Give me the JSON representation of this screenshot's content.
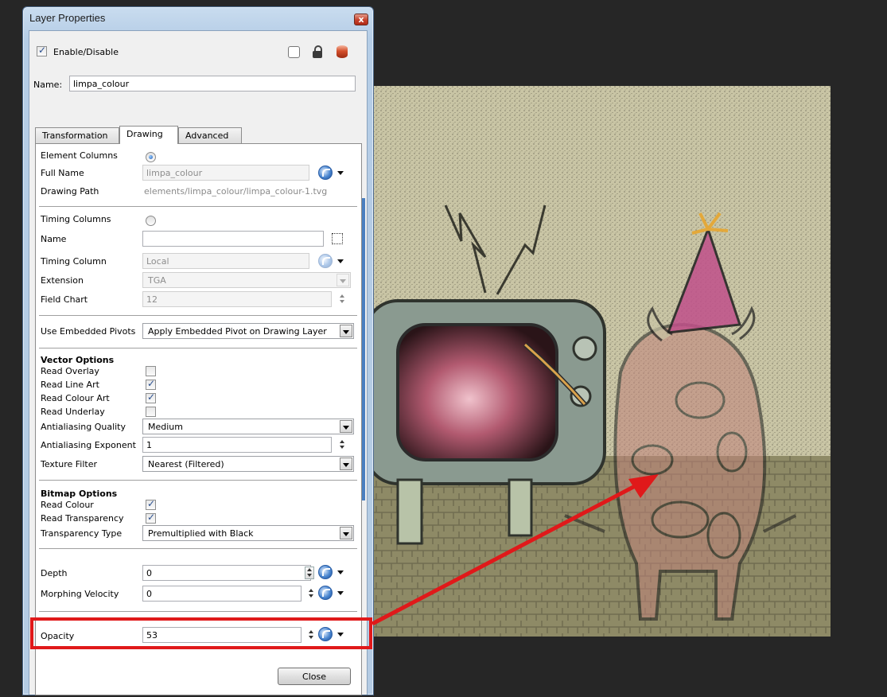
{
  "window": {
    "title": "Layer Properties",
    "close_glyph": "x"
  },
  "header": {
    "enable_label": "Enable/Disable",
    "enable_checked": true,
    "name_label": "Name:",
    "name_value": "limpa_colour"
  },
  "tabs": [
    {
      "label": "Transformation",
      "active": false
    },
    {
      "label": "Drawing",
      "active": true
    },
    {
      "label": "Advanced",
      "active": false
    }
  ],
  "element": {
    "columns_label": "Element Columns",
    "full_name_label": "Full Name",
    "full_name_value": "limpa_colour",
    "drawing_path_label": "Drawing Path",
    "drawing_path_value": "elements/limpa_colour/limpa_colour-1.tvg"
  },
  "timing": {
    "columns_label": "Timing Columns",
    "name_label": "Name",
    "name_value": "",
    "timing_column_label": "Timing Column",
    "timing_column_value": "Local",
    "extension_label": "Extension",
    "extension_value": "TGA",
    "field_chart_label": "Field Chart",
    "field_chart_value": "12"
  },
  "pivots": {
    "label": "Use Embedded Pivots",
    "value": "Apply Embedded Pivot on Drawing Layer"
  },
  "vector": {
    "heading": "Vector Options",
    "read_overlay_label": "Read Overlay",
    "read_overlay": false,
    "read_line_art_label": "Read Line Art",
    "read_line_art": true,
    "read_colour_art_label": "Read Colour Art",
    "read_colour_art": true,
    "read_underlay_label": "Read Underlay",
    "read_underlay": false,
    "aa_quality_label": "Antialiasing Quality",
    "aa_quality_value": "Medium",
    "aa_exponent_label": "Antialiasing Exponent",
    "aa_exponent_value": "1",
    "texture_filter_label": "Texture Filter",
    "texture_filter_value": "Nearest (Filtered)"
  },
  "bitmap": {
    "heading": "Bitmap Options",
    "read_colour_label": "Read Colour",
    "read_colour": true,
    "read_transparency_label": "Read Transparency",
    "read_transparency": true,
    "transparency_type_label": "Transparency Type",
    "transparency_type_value": "Premultiplied with Black"
  },
  "depth": {
    "depth_label": "Depth",
    "depth_value": "0",
    "morphing_label": "Morphing Velocity",
    "morphing_value": "0"
  },
  "opacity": {
    "label": "Opacity",
    "value": "53"
  },
  "footer": {
    "close_label": "Close"
  },
  "colors": {
    "annotation": "#e0191a",
    "window_frame": "#b5cde6",
    "canvas_background": "#262626"
  }
}
